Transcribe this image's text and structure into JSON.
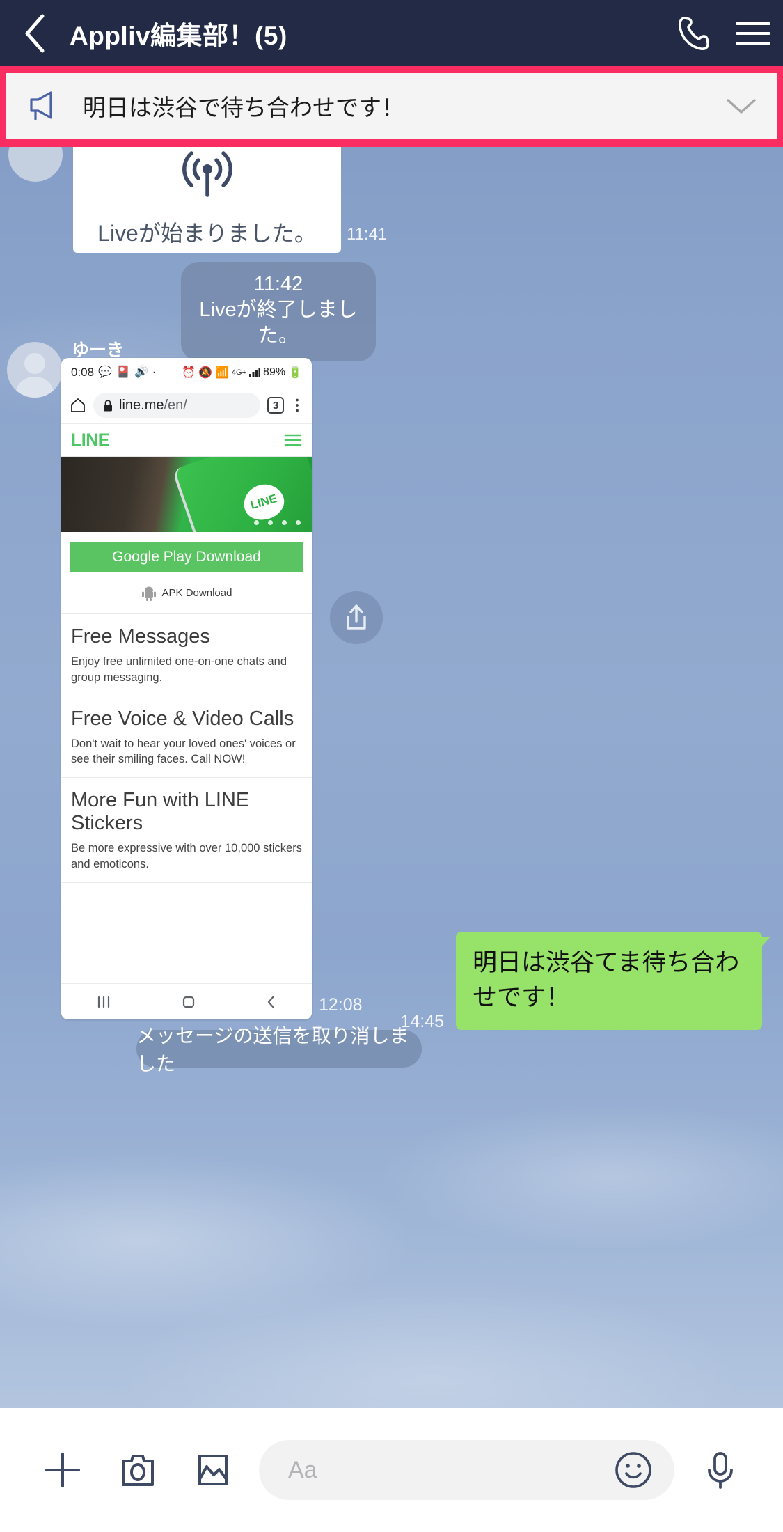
{
  "header": {
    "title": "Appliv編集部！(5)",
    "back_icon": "chevron-left-icon",
    "call_icon": "phone-icon",
    "menu_icon": "hamburger-menu-icon"
  },
  "announcement": {
    "icon": "megaphone-icon",
    "text": "明日は渋谷で待ち合わせです！",
    "expand_icon": "chevron-down-icon",
    "border_color": "#fa2d63",
    "background": "#f4f4f4"
  },
  "chat": {
    "live_started": {
      "icon": "live-broadcast-icon",
      "text": "Liveが始まりました。",
      "time": "11:41"
    },
    "live_ended": {
      "time": "11:42",
      "text": "Liveが終了しました。"
    },
    "attachment_message": {
      "sender": "ゆーき",
      "time": "12:08",
      "share_icon": "share-upload-icon",
      "screenshot": {
        "status_bar": {
          "time": "0:08",
          "left_icons": [
            "line-app-icon",
            "anime-app-icon",
            "cast-icon",
            "dot-icon"
          ],
          "right_icons": [
            "alarm-icon",
            "mute-icon",
            "nfc-icon"
          ],
          "network": "4G+",
          "signal_icon": "signal-bars-icon",
          "battery": "89%",
          "battery_icon": "battery-charging-icon"
        },
        "browser": {
          "home_icon": "home-icon",
          "lock_icon": "lock-icon",
          "url_domain": "line.me",
          "url_path": "/en/",
          "tab_count": "3",
          "more_icon": "three-dot-menu-icon"
        },
        "site": {
          "logo": "LINE",
          "menu_icon": "hamburger-menu-icon",
          "hero_bubble_label": "LINE",
          "download_button": "Google Play Download",
          "apk_icon": "android-robot-icon",
          "apk_label": "APK Download",
          "sections": [
            {
              "heading": "Free Messages",
              "body": "Enjoy free unlimited one-on-one chats and group messaging."
            },
            {
              "heading": "Free Voice & Video Calls",
              "body": "Don't wait to hear your loved ones' voices or see their smiling faces. Call NOW!"
            },
            {
              "heading": "More Fun with LINE Stickers",
              "body": "Be more expressive with over 10,000 stickers and emoticons."
            }
          ]
        },
        "nav_bar": {
          "recents_icon": "recents-bars-icon",
          "home_icon": "home-square-icon",
          "back_icon": "back-chevron-icon"
        }
      }
    },
    "unsent_notice": {
      "text": "メッセージの送信を取り消しました"
    },
    "outgoing": {
      "text": "明日は渋谷てま待ち合わせです！",
      "time": "14:45",
      "bubble_color": "#97e36a"
    }
  },
  "footer": {
    "plus_icon": "plus-icon",
    "camera_icon": "camera-icon",
    "gallery_icon": "image-gallery-icon",
    "input_placeholder": "Aa",
    "emoji_icon": "smiley-face-icon",
    "mic_icon": "microphone-icon"
  }
}
